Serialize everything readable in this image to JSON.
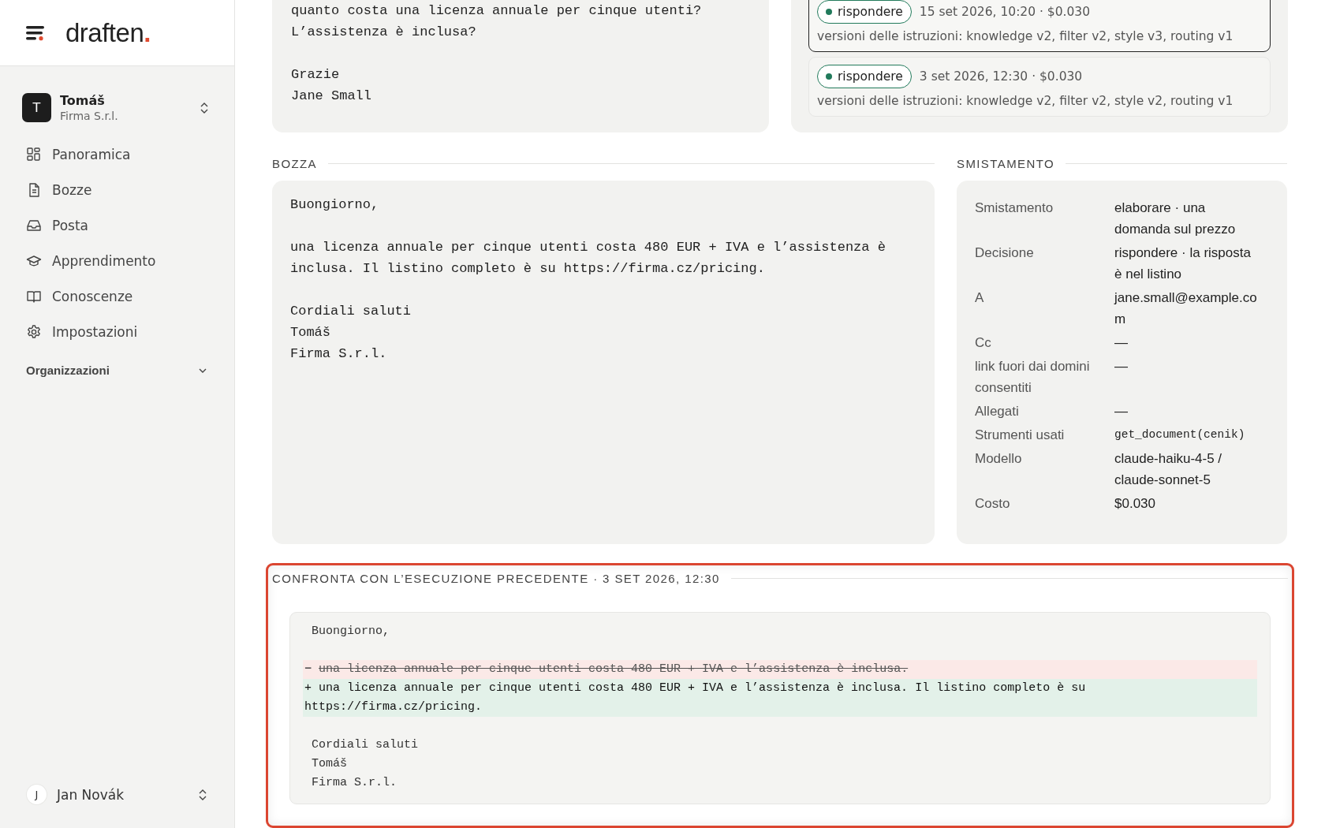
{
  "sidebar": {
    "logo": {
      "name": "draften",
      "mark": "."
    },
    "account": {
      "initial": "T",
      "name": "Tomáš",
      "org": "Firma S.r.l."
    },
    "nav": [
      {
        "label": "Panoramica",
        "selected": false
      },
      {
        "label": "Bozze",
        "selected": false
      },
      {
        "label": "Posta",
        "selected": false
      },
      {
        "label": "Apprendimento",
        "selected": false
      },
      {
        "label": "Conoscenze",
        "selected": false
      },
      {
        "label": "Impostazioni",
        "selected": false
      }
    ],
    "section": {
      "label": "Organizzazioni",
      "expanded": false
    },
    "user": {
      "initial": "J",
      "name": "Jan Novák"
    }
  },
  "email": {
    "paragraphs": [
      [
        "quanto costa una licenza annuale per cinque utenti?",
        "L’assistenza è inclusa?"
      ],
      [
        "Grazie",
        "Jane Small"
      ]
    ]
  },
  "runs": [
    {
      "decision": "rispondere",
      "meta": "15 set 2026, 10:20 · $0.030",
      "versions": "versioni delle istruzioni: knowledge v2, filter v2, style v3, routing v1",
      "selected": true
    },
    {
      "decision": "rispondere",
      "meta": "3 set 2026, 12:30 · $0.030",
      "versions": "versioni delle istruzioni: knowledge v2, filter v2, style v2, routing v1",
      "selected": false
    }
  ],
  "draft": {
    "heading": "BOZZA",
    "paragraphs": [
      [
        "Buongiorno,"
      ],
      [
        "una licenza annuale per cinque utenti costa 480 EUR + IVA e l’assistenza è inclusa. Il listino completo è su https://firma.cz/pricing."
      ],
      [
        "Cordiali saluti",
        "Tomáš",
        "Firma S.r.l."
      ]
    ]
  },
  "routing": {
    "heading": "SMISTAMENTO",
    "rows": [
      {
        "label": "Smistamento",
        "value": "elaborare · una domanda sul prezzo",
        "kind": "text"
      },
      {
        "label": "Decisione",
        "value": "rispondere · la risposta è nel listino",
        "kind": "text"
      },
      {
        "label": "A",
        "value": "jane.small@example.com",
        "kind": "text"
      },
      {
        "label": "Cc",
        "value": "—",
        "kind": "text"
      },
      {
        "label": "link fuori dai domini consentiti",
        "value": "—",
        "kind": "text"
      },
      {
        "label": "Allegati",
        "value": "—",
        "kind": "text"
      },
      {
        "label": "Strumenti usati",
        "value": "get_document(cenik)",
        "kind": "code"
      },
      {
        "label": "Modello",
        "value": "claude-haiku-4-5 / claude-sonnet-5",
        "kind": "text"
      },
      {
        "label": "Costo",
        "value": "$0.030",
        "kind": "text"
      }
    ]
  },
  "comparison": {
    "heading": "CONFRONTA CON L’ESECUZIONE PRECEDENTE · 3 SET 2026, 12:30",
    "highlighted": true,
    "lines": [
      {
        "kind": "same",
        "text": "Buongiorno,"
      },
      {
        "kind": "blank"
      },
      {
        "kind": "removed",
        "sign": "−",
        "text": "una licenza annuale per cinque utenti costa 480 EUR + IVA e l’assistenza è inclusa."
      },
      {
        "kind": "added",
        "sign": "+",
        "text": "una licenza annuale per cinque utenti costa 480 EUR + IVA e l’assistenza è inclusa. Il listino completo è su https://firma.cz/pricing."
      },
      {
        "kind": "blank"
      },
      {
        "kind": "same",
        "text": "Cordiali saluti"
      },
      {
        "kind": "same",
        "text": "Tomáš"
      },
      {
        "kind": "same",
        "text": "Firma S.r.l."
      }
    ]
  }
}
